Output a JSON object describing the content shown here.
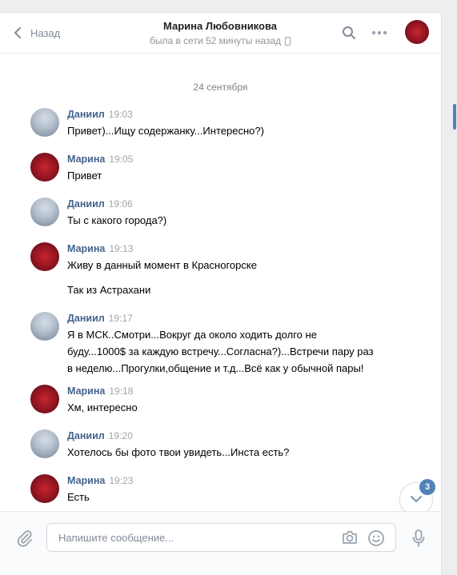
{
  "header": {
    "back_label": "Назад",
    "peer_name": "Марина Любовникова",
    "peer_status": "была в сети 52 минуты назад"
  },
  "date_separator": "24 сентября",
  "messages": [
    {
      "author": "Даниил",
      "time": "19:03",
      "text": "Привет)...Ищу содержанку...Интересно?)",
      "avatar": "daniil"
    },
    {
      "author": "Марина",
      "time": "19:05",
      "text": "Привет",
      "avatar": "marina"
    },
    {
      "author": "Даниил",
      "time": "19:06",
      "text": "Ты с какого города?)",
      "avatar": "daniil"
    },
    {
      "author": "Марина",
      "time": "19:13",
      "text": "Живу в данный момент в Красногорске",
      "text2": "Так из Астрахани",
      "avatar": "marina"
    },
    {
      "author": "Даниил",
      "time": "19:17",
      "lines": [
        "Я в МСК..Смотри...Вокруг да около ходить долго не",
        "буду...1000$ за каждую встречу...Согласна?)...Встречи пару раз",
        "в неделю...Прогулки,общение и т.д...Всё как у обычной пары!"
      ],
      "avatar": "daniil"
    },
    {
      "author": "Марина",
      "time": "19:18",
      "text": "Хм, интересно",
      "avatar": "marina"
    },
    {
      "author": "Даниил",
      "time": "19:20",
      "text": "Хотелось бы фото твои увидеть...Инста есть?",
      "avatar": "daniil"
    },
    {
      "author": "Марина",
      "time": "19:23",
      "text": "Есть",
      "avatar": "marina"
    }
  ],
  "unread_count": "3",
  "composer": {
    "placeholder": "Напишите сообщение..."
  },
  "colors": {
    "accent": "#5181b8",
    "author": "#42648b",
    "background": "#edeef0"
  },
  "icons": [
    "chevron-left-icon",
    "search-icon",
    "more-icon",
    "phone-icon",
    "paperclip-icon",
    "camera-icon",
    "smile-icon",
    "microphone-icon",
    "chevron-down-icon"
  ]
}
